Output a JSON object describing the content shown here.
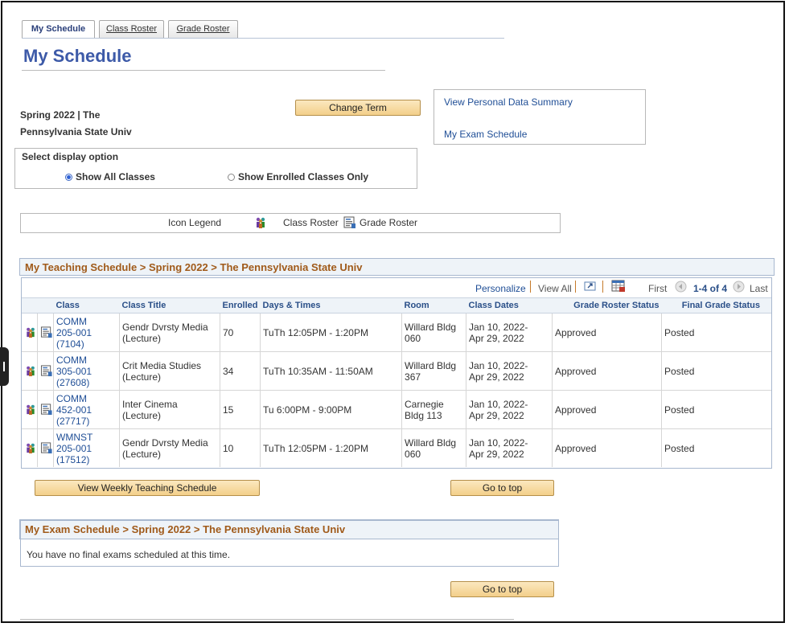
{
  "tabs": [
    {
      "label": "My Schedule",
      "active": true
    },
    {
      "label": "Class Roster",
      "active": false
    },
    {
      "label": "Grade Roster",
      "active": false
    }
  ],
  "page_title": "My Schedule",
  "term": {
    "line1": "Spring 2022 | The",
    "line2": "Pennsylvania State Univ",
    "change_button": "Change Term"
  },
  "links": {
    "personal_data": "View Personal Data Summary",
    "exam_schedule": "My Exam Schedule"
  },
  "display_option": {
    "label": "Select display option",
    "option_all": "Show All Classes",
    "option_enrolled": "Show Enrolled Classes Only",
    "selected": "Show All Classes"
  },
  "legend": {
    "title": "Icon Legend",
    "class_roster": "Class Roster",
    "grade_roster": "Grade Roster"
  },
  "teaching": {
    "header": "My Teaching Schedule > Spring 2022 > The Pennsylvania State Univ",
    "nav": {
      "personalize": "Personalize",
      "view_all": "View All",
      "first": "First",
      "range": "1-4 of 4",
      "last": "Last"
    },
    "columns": [
      "Class",
      "Class Title",
      "Enrolled",
      "Days & Times",
      "Room",
      "Class Dates",
      "Grade Roster Status",
      "Final Grade Status"
    ],
    "rows": [
      {
        "class1": "COMM",
        "class2": "205-001",
        "class3": "(7104)",
        "title1": "Gendr Dvrsty Media",
        "title2": "(Lecture)",
        "enrolled": "70",
        "days": "TuTh 12:05PM - 1:20PM",
        "room1": "Willard Bldg",
        "room2": "060",
        "dates1": "Jan 10, 2022-",
        "dates2": "Apr 29, 2022",
        "roster_status": "Approved",
        "final_status": "Posted"
      },
      {
        "class1": "COMM",
        "class2": "305-001",
        "class3": "(27608)",
        "title1": "Crit Media Studies",
        "title2": "(Lecture)",
        "enrolled": "34",
        "days": "TuTh 10:35AM - 11:50AM",
        "room1": "Willard Bldg",
        "room2": "367",
        "dates1": "Jan 10, 2022-",
        "dates2": "Apr 29, 2022",
        "roster_status": "Approved",
        "final_status": "Posted"
      },
      {
        "class1": "COMM",
        "class2": "452-001",
        "class3": "(27717)",
        "title1": "Inter Cinema",
        "title2": "(Lecture)",
        "enrolled": "15",
        "days": "Tu 6:00PM - 9:00PM",
        "room1": "Carnegie",
        "room2": "Bldg 113",
        "dates1": "Jan 10, 2022-",
        "dates2": "Apr 29, 2022",
        "roster_status": "Approved",
        "final_status": "Posted"
      },
      {
        "class1": "WMNST",
        "class2": "205-001",
        "class3": "(17512)",
        "title1": "Gendr Dvrsty Media",
        "title2": "(Lecture)",
        "enrolled": "10",
        "days": "TuTh 12:05PM - 1:20PM",
        "room1": "Willard Bldg",
        "room2": "060",
        "dates1": "Jan 10, 2022-",
        "dates2": "Apr 29, 2022",
        "roster_status": "Approved",
        "final_status": "Posted"
      }
    ]
  },
  "buttons": {
    "weekly": "View Weekly Teaching Schedule",
    "go_top": "Go to top"
  },
  "exam": {
    "header": "My Exam Schedule > Spring 2022 > The Pennsylvania State Univ",
    "message": "You have no final exams scheduled at this time."
  }
}
